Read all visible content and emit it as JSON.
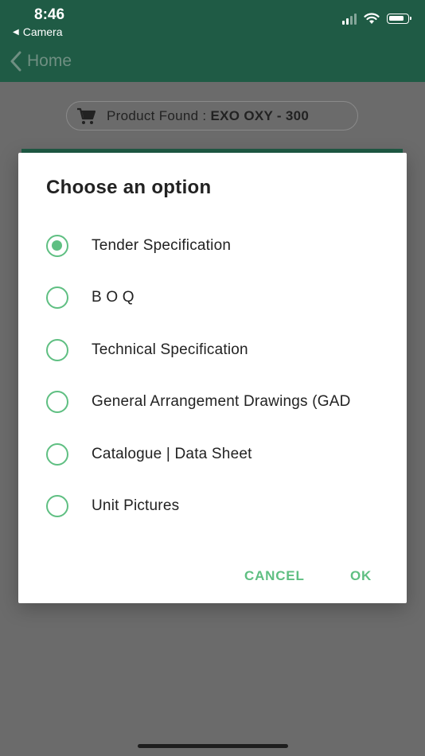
{
  "status_bar": {
    "time": "8:46",
    "back_app": "Camera"
  },
  "nav": {
    "back_label": "Home"
  },
  "product": {
    "prefix": "Product Found :",
    "name": "EXO OXY - 300"
  },
  "dialog": {
    "title": "Choose an option",
    "options": [
      {
        "label": "Tender Specification",
        "checked": true
      },
      {
        "label": "B O Q",
        "checked": false
      },
      {
        "label": "Technical Specification",
        "checked": false
      },
      {
        "label": "General Arrangement Drawings (GAD",
        "checked": false
      },
      {
        "label": "Catalogue | Data Sheet",
        "checked": false
      },
      {
        "label": "Unit Pictures",
        "checked": false
      }
    ],
    "cancel_label": "CANCEL",
    "ok_label": "OK"
  },
  "colors": {
    "header": "#1f5b45",
    "accent": "#5fbf82",
    "overlay": "#6b6b6b"
  },
  "icons": [
    "signal-icon",
    "wifi-icon",
    "battery-icon",
    "chevron-left-icon",
    "cart-icon"
  ]
}
